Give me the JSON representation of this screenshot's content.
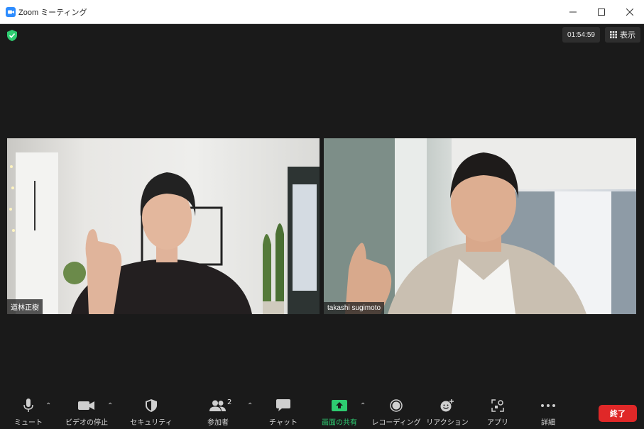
{
  "window": {
    "title": "Zoom ミーティング"
  },
  "meeting": {
    "timer": "01:54:59",
    "view_label": "表示",
    "participants": [
      {
        "name": "道林正樹"
      },
      {
        "name": "takashi sugimoto"
      }
    ]
  },
  "toolbar": {
    "mute": "ミュート",
    "video": "ビデオの停止",
    "security": "セキュリティ",
    "participants": "参加者",
    "participants_count": "2",
    "chat": "チャット",
    "share": "画面の共有",
    "record": "レコーディング",
    "reactions": "リアクション",
    "apps": "アプリ",
    "more": "詳細",
    "end": "終了"
  },
  "colors": {
    "end": "#e02828",
    "share": "#2ecc71",
    "zoom_blue": "#2d8cff",
    "shield": "#2ecc71"
  }
}
